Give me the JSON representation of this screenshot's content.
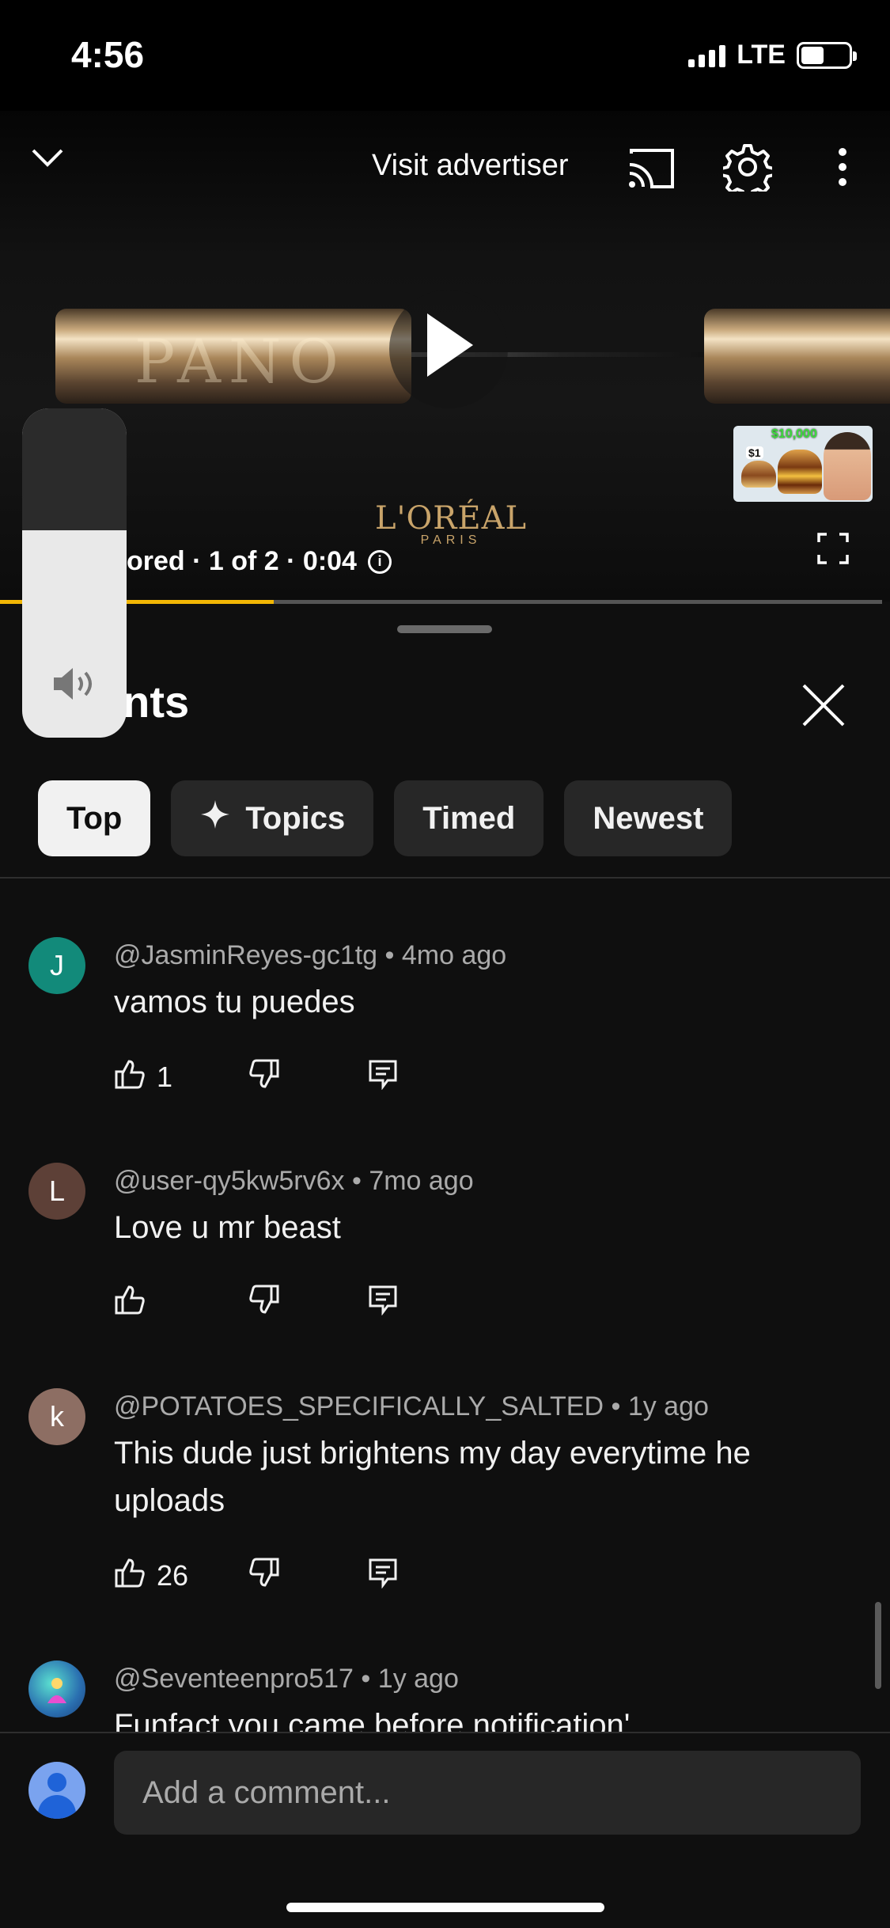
{
  "status": {
    "time": "4:56",
    "network": "LTE"
  },
  "player": {
    "visit_advertiser": "Visit advertiser",
    "ad_brand": "L'ORÉAL",
    "ad_brand_sub": "PARIS",
    "tube_text": "PANO",
    "ad_info": "ored · 1 of 2 · 0:04",
    "progress_fraction": 0.31,
    "thumb_price_big": "$10,000",
    "thumb_price_small": "$1"
  },
  "volume": {
    "level_fraction": 0.63
  },
  "comments": {
    "title": "nments",
    "filters": [
      {
        "label": "Top",
        "active": true
      },
      {
        "label": "Topics",
        "icon": "sparkle-icon",
        "active": false
      },
      {
        "label": "Timed",
        "active": false
      },
      {
        "label": "Newest",
        "active": false
      }
    ],
    "items": [
      {
        "initial": "J",
        "avatar_color": "#128a7a",
        "author": "@JasminReyes-gc1tg",
        "age": "4mo ago",
        "text": "vamos tu puedes",
        "likes": "1"
      },
      {
        "initial": "L",
        "avatar_color": "#5d4037",
        "author": "@user-qy5kw5rv6x",
        "age": "7mo ago",
        "text": "Love u mr beast",
        "likes": ""
      },
      {
        "initial": "k",
        "avatar_color": "#8d6e63",
        "author": "@POTATOES_SPECIFICALLY_SALTED",
        "age": "1y ago",
        "text": "This dude just brightens my day everytime he uploads",
        "likes": "26"
      },
      {
        "initial": "",
        "avatar_color": "#2a6fb0",
        "author": "@Seventeenpro517",
        "age": "1y ago",
        "text": "Funfact you came before notification'",
        "likes": ""
      }
    ],
    "separator": "•",
    "add_placeholder": "Add a comment..."
  }
}
